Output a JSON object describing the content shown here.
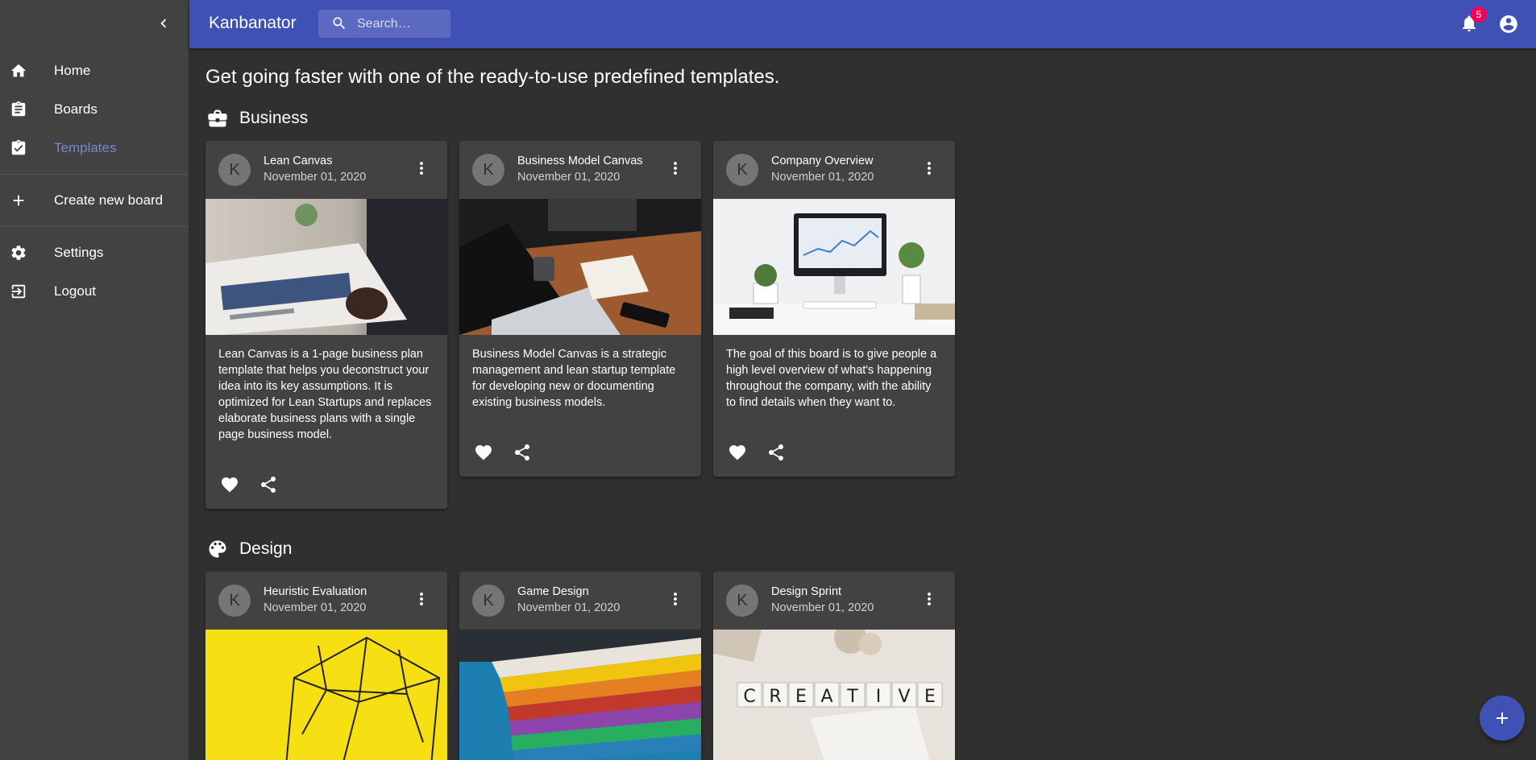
{
  "app": {
    "title": "Kanbanator"
  },
  "search": {
    "placeholder": "Search…"
  },
  "notifications": {
    "count": "5"
  },
  "sidebar": {
    "items": [
      {
        "label": "Home",
        "icon": "home-icon"
      },
      {
        "label": "Boards",
        "icon": "clipboard-icon"
      },
      {
        "label": "Templates",
        "icon": "clipboard-check-icon",
        "active": true
      },
      {
        "label": "Create new board",
        "icon": "plus-icon"
      },
      {
        "label": "Settings",
        "icon": "gear-icon"
      },
      {
        "label": "Logout",
        "icon": "logout-icon"
      }
    ]
  },
  "main": {
    "intro": "Get going faster with one of the ready-to-use predefined templates.",
    "sections": [
      {
        "title": "Business",
        "icon": "briefcase-icon",
        "cards": [
          {
            "avatar": "K",
            "title": "Lean Canvas",
            "date": "November 01, 2020",
            "image": "business-newspaper-photo",
            "description": "Lean Canvas is a 1-page business plan template that helps you deconstruct your idea into its key assumptions. It is optimized for Lean Startups and replaces elaborate business plans with a single page business model."
          },
          {
            "avatar": "K",
            "title": "Business Model Canvas",
            "date": "November 01, 2020",
            "image": "laptop-desk-photo",
            "description": "Business Model Canvas is a strategic management and lean startup template for developing new or documenting existing business models."
          },
          {
            "avatar": "K",
            "title": "Company Overview",
            "date": "November 01, 2020",
            "image": "office-desk-monitor-photo",
            "description": "The goal of this board is to give people a high level overview of what's happening throughout the company, with the ability to find details when they want to."
          }
        ]
      },
      {
        "title": "Design",
        "icon": "palette-icon",
        "cards": [
          {
            "avatar": "K",
            "title": "Heuristic Evaluation",
            "date": "November 01, 2020",
            "image": "wire-sculpture-yellow-photo"
          },
          {
            "avatar": "K",
            "title": "Game Design",
            "date": "November 01, 2020",
            "image": "color-swatches-photo"
          },
          {
            "avatar": "K",
            "title": "Design Sprint",
            "date": "November 01, 2020",
            "image": "creative-letter-tiles-photo",
            "image_text": "CREATIVE"
          }
        ]
      }
    ]
  },
  "colors": {
    "appbar": "#3f51b5",
    "active_nav": "#7986cb",
    "badge": "#f50057",
    "background": "#303030",
    "surface": "#424242"
  }
}
